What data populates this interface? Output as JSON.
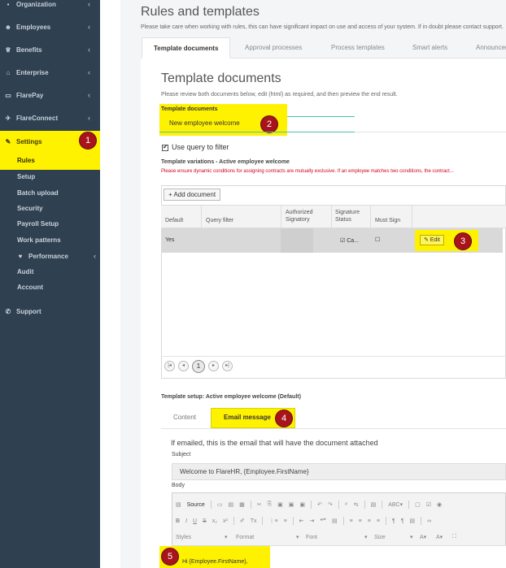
{
  "sidebar": {
    "items": [
      {
        "label": "Organization",
        "icon": "sitemap-icon",
        "glyph": "▪"
      },
      {
        "label": "Employees",
        "icon": "users-icon",
        "glyph": "☻"
      },
      {
        "label": "Benefits",
        "icon": "trophy-icon",
        "glyph": "♕"
      },
      {
        "label": "Enterprise",
        "icon": "building-icon",
        "glyph": "⌂"
      },
      {
        "label": "FlarePay",
        "icon": "money-icon",
        "glyph": "▭"
      },
      {
        "label": "FlareConnect",
        "icon": "rocket-icon",
        "glyph": "✈"
      }
    ],
    "settings": {
      "label": "Settings",
      "icon": "edit-icon",
      "glyph": "✎"
    },
    "sub_items": [
      "Rules",
      "Setup",
      "Batch upload",
      "Security",
      "Payroll Setup",
      "Work patterns",
      "Performance",
      "Audit",
      "Account"
    ],
    "performance_glyph": "♥",
    "support": {
      "label": "Support",
      "icon": "phone-icon",
      "glyph": "✆"
    },
    "chevron": "‹"
  },
  "header": {
    "title": "Rules and templates",
    "description": "Please take care when working with rules, this can have significant impact on use and access of your system. If in doubt please contact support."
  },
  "tabs": [
    "Template documents",
    "Approval processes",
    "Process templates",
    "Smart alerts",
    "Announcements"
  ],
  "section": {
    "title": "Template documents",
    "description": "Please review both documents below, edit (html) as required, and then preview the end result.",
    "field_label": "Template documents",
    "field_value": "New employee welcome",
    "use_query_label": "Use query to filter",
    "checkmark": "✔",
    "variations_title": "Template variations - Active employee welcome",
    "warning": "Please ensure dynamic conditions for assigning contracts are mutually exclusive. If an employee matches two conditions, the contract..."
  },
  "grid": {
    "add_button": "+ Add document",
    "columns": [
      "Default",
      "Query filter",
      "Authorized Signatory",
      "Signature Status",
      "Must Sign"
    ],
    "row": {
      "default": "Yes",
      "query": "",
      "signatory": "",
      "signature_status": "☑ Ca...",
      "must_sign": "☐"
    },
    "edit_button": "✎ Edit",
    "pager": {
      "first": "|◂",
      "prev": "◂",
      "page": "1",
      "next": "▸",
      "last": "▸|"
    }
  },
  "setup": {
    "title": "Template setup: Active employee welcome (Default)",
    "tabs": [
      "Content",
      "Email message"
    ],
    "email_title": "If emailed, this is the email that will have the document attached",
    "subject_label": "Subject",
    "subject_value": "Welcome to FlareHR, {Employee.FirstName}",
    "body_label": "Body",
    "toolbar_row1": [
      "Source",
      "|",
      "▭",
      "▤",
      "▦",
      "|",
      "✂",
      "⎘",
      "▣",
      "▣",
      "▣",
      "|",
      "↶",
      "↷",
      "|",
      "⌕",
      "⇆",
      "|",
      "▤",
      "|",
      "ABC▾",
      "|",
      "▢",
      "☑",
      "◉"
    ],
    "toolbar_row2": [
      "B",
      "I",
      "U",
      "S",
      "x₂",
      "x²",
      "|",
      "✐",
      "Tx",
      "|",
      "⋮≡",
      "≡",
      "|",
      "⇤",
      "⇥",
      "❝❞",
      "▤",
      "|",
      "≡",
      "≡",
      "≡",
      "≡",
      "|",
      "¶",
      "¶",
      "▤",
      "|",
      "∞"
    ],
    "toolbar_row3": [
      "Styles",
      "▾",
      "Format",
      "▾",
      "Font",
      "▾",
      "Size",
      "▾",
      "A▾",
      "A▾",
      "⛶"
    ],
    "body_text": "Hi {Employee.FirstName},"
  },
  "annotations": [
    "1",
    "2",
    "3",
    "4",
    "5"
  ],
  "colors": {
    "sidebar": "#2f4050",
    "highlight": "#fff200",
    "badge": "#a8141c",
    "teal": "#4cc1b3",
    "warning": "#d0021b"
  }
}
